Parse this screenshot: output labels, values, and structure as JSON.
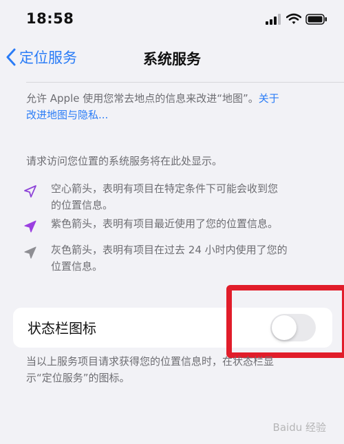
{
  "status_bar": {
    "time": "18:58"
  },
  "nav": {
    "back_label": "定位服务",
    "title": "系统服务"
  },
  "info_text_1": "允许 Apple 使用您常去地点的信息来改进“地图”。",
  "info_link_line1": "关于",
  "info_link_line2": "改进地图与隐私...",
  "system_services_note": "请求访问您位置的系统服务将在此处显示。",
  "legend": [
    {
      "icon": "hollow-arrow-icon",
      "color": "#8e44d8",
      "line1": "空心箭头，表明有项目在特定条件下可能会收到您",
      "line2": "的位置信息。"
    },
    {
      "icon": "purple-arrow-icon",
      "color": "#9b3fe0",
      "line1": "紫色箭头，表明有项目最近使用了您的位置信息。",
      "line2": ""
    },
    {
      "icon": "gray-arrow-icon",
      "color": "#8e8e93",
      "line1": "灰色箭头，表明有项目在过去 24 小时内使用了您的",
      "line2": "位置信息。"
    }
  ],
  "status_bar_icon": {
    "label": "状态栏图标",
    "toggle_on": false
  },
  "footer_line1": "当以上服务项目请求获得您的位置信息时，在状态栏显",
  "footer_line2": "示“定位服务”的图标。",
  "watermark": "Baidu 经验"
}
